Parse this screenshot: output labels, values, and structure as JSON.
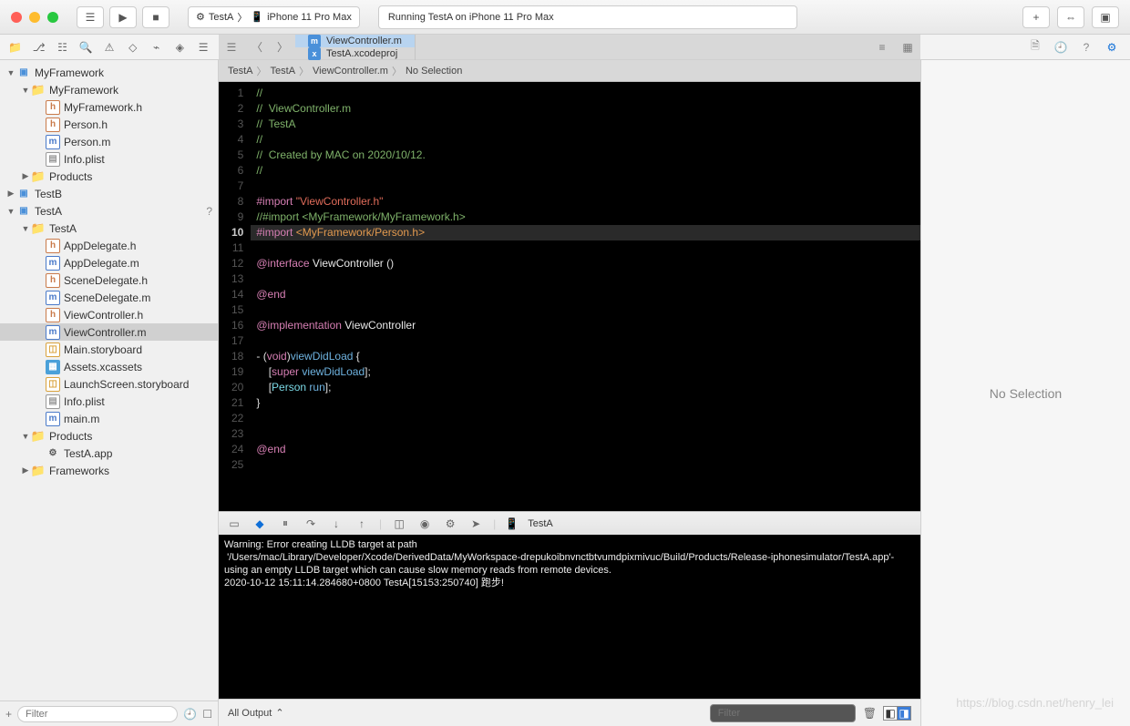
{
  "titlebar": {
    "scheme_app": "TestA",
    "scheme_device": "iPhone 11 Pro Max",
    "status": "Running TestA on iPhone 11 Pro Max"
  },
  "tabs": [
    {
      "icon": "m",
      "label": "ViewController.m",
      "active": true
    },
    {
      "icon": "x",
      "label": "TestA.xcodeproj",
      "active": false
    }
  ],
  "jump_bar": [
    "TestA",
    "TestA",
    "ViewController.m",
    "No Selection"
  ],
  "navigator": {
    "tree": [
      {
        "depth": 0,
        "kind": "proj",
        "label": "MyFramework",
        "disc": "▼"
      },
      {
        "depth": 1,
        "kind": "folder",
        "label": "MyFramework",
        "disc": "▼"
      },
      {
        "depth": 2,
        "kind": "h",
        "label": "MyFramework.h"
      },
      {
        "depth": 2,
        "kind": "h",
        "label": "Person.h"
      },
      {
        "depth": 2,
        "kind": "m",
        "label": "Person.m"
      },
      {
        "depth": 2,
        "kind": "plist",
        "label": "Info.plist"
      },
      {
        "depth": 1,
        "kind": "folder",
        "label": "Products",
        "disc": "▶"
      },
      {
        "depth": 0,
        "kind": "proj",
        "label": "TestB",
        "disc": "▶"
      },
      {
        "depth": 0,
        "kind": "proj",
        "label": "TestA",
        "disc": "▼",
        "badge": "?"
      },
      {
        "depth": 1,
        "kind": "folder",
        "label": "TestA",
        "disc": "▼"
      },
      {
        "depth": 2,
        "kind": "h",
        "label": "AppDelegate.h"
      },
      {
        "depth": 2,
        "kind": "m",
        "label": "AppDelegate.m"
      },
      {
        "depth": 2,
        "kind": "h",
        "label": "SceneDelegate.h"
      },
      {
        "depth": 2,
        "kind": "m",
        "label": "SceneDelegate.m"
      },
      {
        "depth": 2,
        "kind": "h",
        "label": "ViewController.h"
      },
      {
        "depth": 2,
        "kind": "m",
        "label": "ViewController.m",
        "selected": true
      },
      {
        "depth": 2,
        "kind": "story",
        "label": "Main.storyboard"
      },
      {
        "depth": 2,
        "kind": "assets",
        "label": "Assets.xcassets"
      },
      {
        "depth": 2,
        "kind": "story",
        "label": "LaunchScreen.storyboard"
      },
      {
        "depth": 2,
        "kind": "plist",
        "label": "Info.plist"
      },
      {
        "depth": 2,
        "kind": "m",
        "label": "main.m"
      },
      {
        "depth": 1,
        "kind": "folder",
        "label": "Products",
        "disc": "▼"
      },
      {
        "depth": 2,
        "kind": "app",
        "label": "TestA.app"
      },
      {
        "depth": 1,
        "kind": "folder",
        "label": "Frameworks",
        "disc": "▶"
      }
    ],
    "filter_placeholder": "Filter"
  },
  "code": {
    "highlight_line": 10,
    "lines": [
      [
        {
          "c": "comment",
          "t": "//"
        }
      ],
      [
        {
          "c": "comment",
          "t": "//  ViewController.m"
        }
      ],
      [
        {
          "c": "comment",
          "t": "//  TestA"
        }
      ],
      [
        {
          "c": "comment",
          "t": "//"
        }
      ],
      [
        {
          "c": "comment",
          "t": "//  Created by MAC on 2020/10/12."
        }
      ],
      [
        {
          "c": "comment",
          "t": "//"
        }
      ],
      [],
      [
        {
          "c": "keyword",
          "t": "#import "
        },
        {
          "c": "string",
          "t": "\"ViewController.h\""
        }
      ],
      [
        {
          "c": "comment",
          "t": "//#import <MyFramework/MyFramework.h>"
        }
      ],
      [
        {
          "c": "keyword",
          "t": "#import "
        },
        {
          "c": "angle",
          "t": "<MyFramework/Person.h>"
        }
      ],
      [],
      [
        {
          "c": "keyword",
          "t": "@interface"
        },
        {
          "c": "",
          "t": " "
        },
        {
          "c": "class",
          "t": "ViewController"
        },
        {
          "c": "",
          "t": " ()"
        }
      ],
      [],
      [
        {
          "c": "keyword",
          "t": "@end"
        }
      ],
      [],
      [
        {
          "c": "keyword",
          "t": "@implementation"
        },
        {
          "c": "",
          "t": " "
        },
        {
          "c": "class",
          "t": "ViewController"
        }
      ],
      [],
      [
        {
          "c": "",
          "t": "- ("
        },
        {
          "c": "keyword",
          "t": "void"
        },
        {
          "c": "",
          "t": ")"
        },
        {
          "c": "func",
          "t": "viewDidLoad"
        },
        {
          "c": "",
          "t": " {"
        }
      ],
      [
        {
          "c": "",
          "t": "    ["
        },
        {
          "c": "keyword",
          "t": "super"
        },
        {
          "c": "",
          "t": " "
        },
        {
          "c": "func",
          "t": "viewDidLoad"
        },
        {
          "c": "",
          "t": "];"
        }
      ],
      [
        {
          "c": "",
          "t": "    ["
        },
        {
          "c": "type",
          "t": "Person"
        },
        {
          "c": "",
          "t": " "
        },
        {
          "c": "func",
          "t": "run"
        },
        {
          "c": "",
          "t": "];"
        }
      ],
      [
        {
          "c": "",
          "t": "}"
        }
      ],
      [],
      [],
      [
        {
          "c": "keyword",
          "t": "@end"
        }
      ],
      []
    ]
  },
  "debug": {
    "target": "TestA"
  },
  "console": {
    "text": "Warning: Error creating LLDB target at path\n '/Users/mac/Library/Developer/Xcode/DerivedData/MyWorkspace-drepukoibnvnctbtvumdpixmivuc/Build/Products/Release-iphonesimulator/TestA.app'- using an empty LLDB target which can cause slow memory reads from remote devices.\n2020-10-12 15:11:14.284680+0800 TestA[15153:250740] 跑步!",
    "footer_label": "All Output",
    "filter_placeholder": "Filter"
  },
  "inspector": {
    "label": "No Selection"
  },
  "watermark": "https://blog.csdn.net/henry_lei"
}
